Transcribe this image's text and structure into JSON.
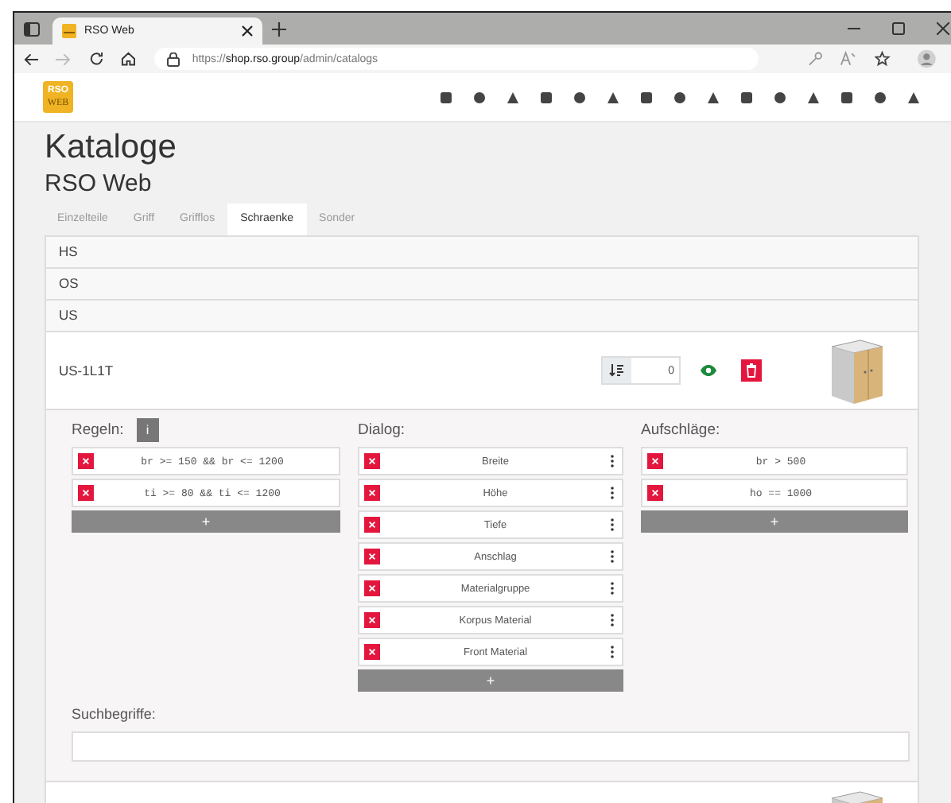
{
  "browser": {
    "tab_title": "RSO Web",
    "url_scheme": "https://",
    "url_host": "shop.rso.group",
    "url_path": "/admin/catalogs"
  },
  "logo": {
    "line1": "RSO",
    "line2": "WEB"
  },
  "page_title": "Kataloge",
  "subtitle": "RSO Web",
  "tabs": [
    {
      "label": "Einzelteile",
      "selected": false
    },
    {
      "label": "Griff",
      "selected": false
    },
    {
      "label": "Grifflos",
      "selected": false
    },
    {
      "label": "Schraenke",
      "selected": true
    },
    {
      "label": "Sonder",
      "selected": false
    }
  ],
  "groups": [
    {
      "label": "HS"
    },
    {
      "label": "OS"
    },
    {
      "label": "US"
    }
  ],
  "item": {
    "name": "US-1L1T",
    "sort_value": "0",
    "visible": true
  },
  "rules": {
    "title": "Regeln:",
    "info": "i",
    "add": "+",
    "items": [
      {
        "text": "br >= 150 && br <= 1200"
      },
      {
        "text": "ti >= 80 && ti <= 1200"
      }
    ]
  },
  "dialog": {
    "title": "Dialog:",
    "add": "+",
    "items": [
      {
        "text": "Breite"
      },
      {
        "text": "Höhe"
      },
      {
        "text": "Tiefe"
      },
      {
        "text": "Anschlag"
      },
      {
        "text": "Materialgruppe"
      },
      {
        "text": "Korpus Material"
      },
      {
        "text": "Front Material"
      }
    ]
  },
  "surcharges": {
    "title": "Aufschläge:",
    "add": "+",
    "items": [
      {
        "text": "br > 500"
      },
      {
        "text": "ho == 1000"
      }
    ]
  },
  "search_terms": {
    "label": "Suchbegriffe:"
  }
}
